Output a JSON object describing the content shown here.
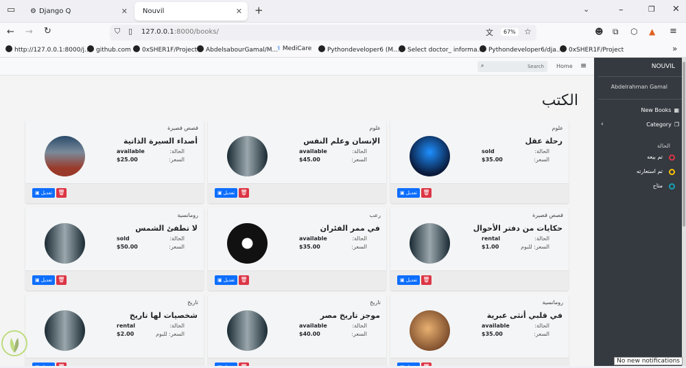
{
  "browser": {
    "tabs": [
      {
        "label": "Django Q",
        "active": false
      },
      {
        "label": "Nouvil",
        "active": true
      }
    ],
    "url_host": "127.0.0.1",
    "url_path": ":8000/books/",
    "zoom": "67%",
    "bookmarks": [
      "http://127.0.0.1:8000/j...",
      "github.com",
      "0xSHER1F/Project",
      "AbdelsabourGamal/M...",
      "MediCare",
      "Pythondeveloper6 (M...",
      "Select doctor_ informa...",
      "Pythondeveloper6/dja...",
      "0xSHER1F/Project"
    ]
  },
  "topnav": {
    "search_placeholder": "Search",
    "home": "Home"
  },
  "page_title": "الكتب",
  "labels": {
    "status": "الحالة:",
    "price": "السعر:",
    "price_per_day": "السعر: للبوم",
    "edit": "تعديل"
  },
  "cards": [
    {
      "category": "علوم",
      "title": "رحلة عقل",
      "status": "sold",
      "price": "$35.00",
      "price_label": "السعر:"
    },
    {
      "category": "علوم",
      "title": "الإنسان وعلم النفس",
      "status": "available",
      "price": "$45.00",
      "price_label": "السعر:"
    },
    {
      "category": "قصص قصيرة",
      "title": "أصداء السيرة الذاتية",
      "status": "available",
      "price": "$25.00",
      "price_label": "السعر:"
    },
    {
      "category": "قصص قصيرة",
      "title": "حكايات من دفتر الأحوال",
      "status": "rental",
      "price": "$1.00",
      "price_label": "السعر: للبوم"
    },
    {
      "category": "رعب",
      "title": "في ممر الفئران",
      "status": "available",
      "price": "$35.00",
      "price_label": "السعر:"
    },
    {
      "category": "رومانسية",
      "title": "لا تطفئ الشمس",
      "status": "sold",
      "price": "$50.00",
      "price_label": "السعر:"
    },
    {
      "category": "رومانسية",
      "title": "في قلبي أنثى عبرية",
      "status": "available",
      "price": "$35.00",
      "price_label": "السعر:"
    },
    {
      "category": "تاريخ",
      "title": "موجز تاريخ مصر",
      "status": "available",
      "price": "$40.00",
      "price_label": "السعر:"
    },
    {
      "category": "تاريخ",
      "title": "شخصيات لها تاريخ",
      "status": "rental",
      "price": "$2.00",
      "price_label": "السعر: للبوم"
    }
  ],
  "sidebar": {
    "brand": "NOUVIL",
    "user": "Abdelrahman Gamal",
    "new_books": "New Books",
    "category": "Category",
    "status_heading": "الحالة",
    "legend": [
      {
        "label": "تم بيعه",
        "color": "#dc3545"
      },
      {
        "label": "تم استعارته",
        "color": "#ffc107"
      },
      {
        "label": "متاح",
        "color": "#17a2b8"
      }
    ]
  },
  "notification": "No new notifications"
}
